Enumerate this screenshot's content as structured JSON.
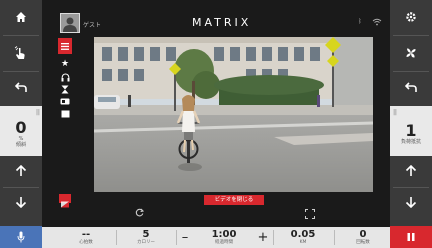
{
  "header": {
    "user_name": "ゲスト",
    "logo": "MATRIX"
  },
  "left_panel": {
    "level": {
      "value": "0",
      "unit": "%",
      "label": "傾斜"
    }
  },
  "right_panel": {
    "level": {
      "value": "1",
      "label": "負荷抵抗"
    }
  },
  "media": {
    "close_video_label": "ビデオを閉じる"
  },
  "stats": [
    {
      "value": "--",
      "label": "心拍数"
    },
    {
      "value": "5",
      "label": "カロリー"
    },
    {
      "value": "1:00",
      "label": "経過時間"
    },
    {
      "value": "0.05",
      "label": "KM"
    },
    {
      "value": "0",
      "label": "回転数"
    }
  ],
  "colors": {
    "accent": "#d8282e",
    "sidebar": "#3a3a3a",
    "bottombar": "#e6e6e6"
  }
}
